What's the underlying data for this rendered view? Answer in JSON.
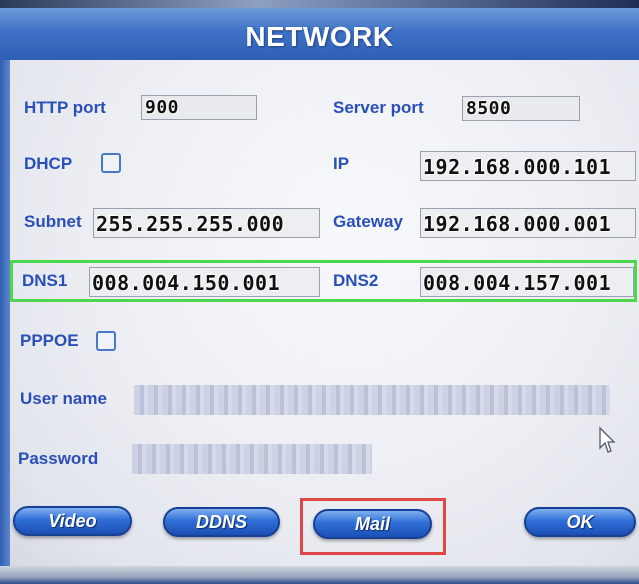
{
  "title": "NETWORK",
  "fields": {
    "http_port": {
      "label": "HTTP port",
      "value": "900"
    },
    "server_port": {
      "label": "Server port",
      "value": "8500"
    },
    "dhcp": {
      "label": "DHCP",
      "checked": false
    },
    "ip": {
      "label": "IP",
      "value": "192.168.000.101"
    },
    "subnet": {
      "label": "Subnet",
      "value": "255.255.255.000"
    },
    "gateway": {
      "label": "Gateway",
      "value": "192.168.000.001"
    },
    "dns1": {
      "label": "DNS1",
      "value": "008.004.150.001"
    },
    "dns2": {
      "label": "DNS2",
      "value": "008.004.157.001"
    },
    "pppoe": {
      "label": "PPPOE",
      "checked": false
    },
    "user_name": {
      "label": "User name",
      "value": ""
    },
    "password": {
      "label": "Password",
      "value": ""
    }
  },
  "buttons": {
    "video": "Video",
    "ddns": "DDNS",
    "mail": "Mail",
    "ok": "OK"
  },
  "colors": {
    "label_blue": "#2a4fb8",
    "title_bar": "#3f72c6",
    "dns_highlight": "#4ed64e",
    "mail_highlight": "#e04646"
  },
  "icons": {
    "cursor": "mouse-pointer-icon",
    "checkbox": "checkbox-icon"
  }
}
